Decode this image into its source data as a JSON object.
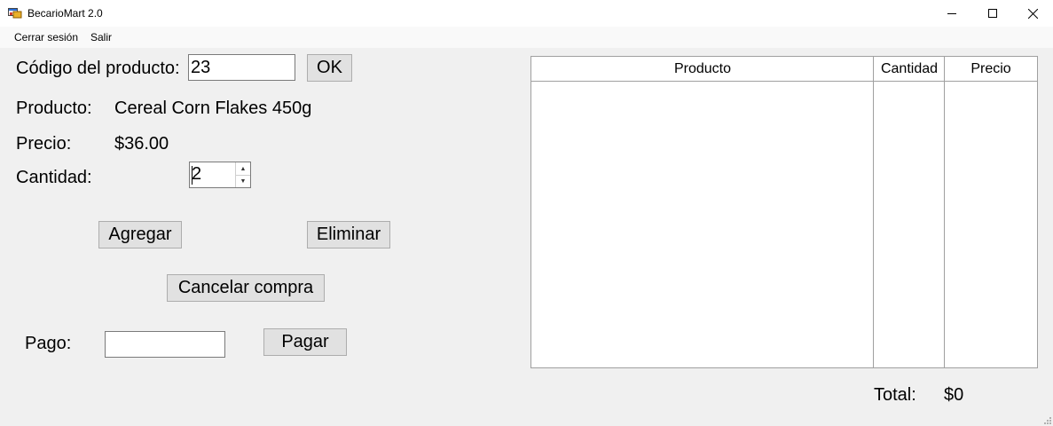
{
  "window": {
    "title": "BecarioMart 2.0",
    "controls": {
      "minimize": "minimize",
      "maximize": "maximize",
      "close": "close"
    }
  },
  "menu": {
    "items": [
      {
        "label": "Cerrar sesión"
      },
      {
        "label": "Salir"
      }
    ]
  },
  "form": {
    "codigo_label": "Código del producto:",
    "codigo_value": "23",
    "ok_label": "OK",
    "producto_label": "Producto:",
    "producto_value": "Cereal Corn Flakes 450g",
    "precio_label": "Precio:",
    "precio_value": "$36.00",
    "cantidad_label": "Cantidad:",
    "cantidad_value": "2",
    "agregar_label": "Agregar",
    "eliminar_label": "Eliminar",
    "cancelar_label": "Cancelar compra",
    "pago_label": "Pago:",
    "pago_value": "",
    "pagar_label": "Pagar"
  },
  "table": {
    "columns": [
      "Producto",
      "Cantidad",
      "Precio"
    ],
    "rows": []
  },
  "totals": {
    "total_label": "Total:",
    "total_value": "$0"
  },
  "icons": {
    "app": "app-window-icon",
    "minimize": "minimize-icon",
    "maximize": "maximize-icon",
    "close": "close-icon",
    "spin_up": "chevron-up-icon",
    "spin_down": "chevron-down-icon",
    "resize": "resize-grip-icon"
  }
}
